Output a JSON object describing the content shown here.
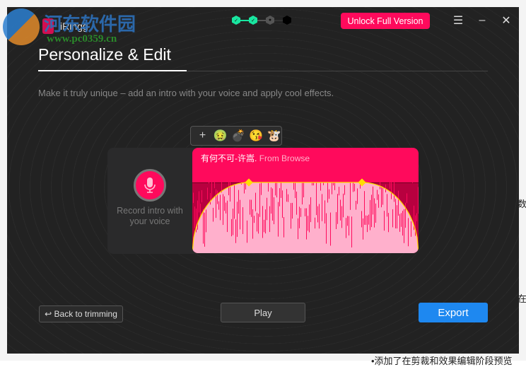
{
  "watermark": {
    "site_name": "河东软件园",
    "url": "www.pc0359.cn"
  },
  "background_doc": {
    "text1": "数",
    "text2": "在",
    "text3": "•添加了在剪裁和效果编辑阶段预览"
  },
  "app": {
    "name": "iRingg"
  },
  "steps": [
    {
      "state": "done"
    },
    {
      "state": "done"
    },
    {
      "state": "current"
    },
    {
      "state": "pending"
    }
  ],
  "header": {
    "unlock_label": "Unlock Full Version",
    "menu_icon": "hamburger-icon",
    "minimize_icon": "minimize-icon",
    "close_icon": "close-icon"
  },
  "page": {
    "title": "Personalize & Edit",
    "subtitle": "Make it truly unique – add an intro with your voice and apply cool effects."
  },
  "effects": {
    "add_label": "+",
    "items": [
      {
        "name": "nauseated-face",
        "glyph": "🤢"
      },
      {
        "name": "bomb",
        "glyph": "💣"
      },
      {
        "name": "kissing-face",
        "glyph": "😘"
      },
      {
        "name": "cow-face",
        "glyph": "🐮"
      }
    ]
  },
  "record": {
    "label": "Record intro with your voice"
  },
  "track": {
    "title": "有何不可-许嵩.",
    "source": "From Browse"
  },
  "buttons": {
    "back": "Back to trimming",
    "play": "Play",
    "export": "Export"
  },
  "colors": {
    "accent": "#ff0a5c",
    "primary": "#1e88f0",
    "step_done": "#19e6a0",
    "fade_curve": "#ffdd00"
  }
}
